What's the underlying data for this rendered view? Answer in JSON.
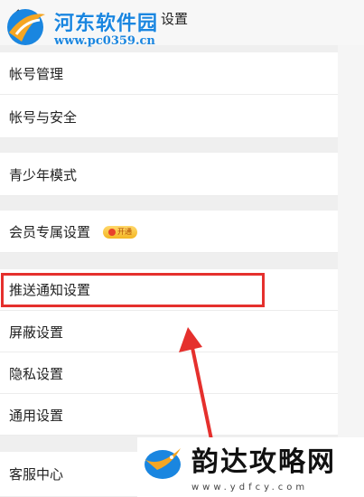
{
  "header": {
    "title": "设置"
  },
  "watermark_top": {
    "name": "河东软件园",
    "url": "www.pc0359.cn"
  },
  "settings": {
    "items": [
      {
        "label": "帐号管理"
      },
      {
        "label": "帐号与安全"
      },
      {
        "label": "青少年模式"
      },
      {
        "label": "会员专属设置"
      },
      {
        "label": "推送通知设置"
      },
      {
        "label": "屏蔽设置"
      },
      {
        "label": "隐私设置"
      },
      {
        "label": "通用设置"
      },
      {
        "label": "客服中心"
      }
    ],
    "vip_badge": "开通"
  },
  "watermark_bottom": {
    "name": "韵达攻略网",
    "url": "www.ydfcy.com"
  },
  "colors": {
    "highlight": "#e5302d",
    "watermark_blue": "#1a86e0"
  }
}
